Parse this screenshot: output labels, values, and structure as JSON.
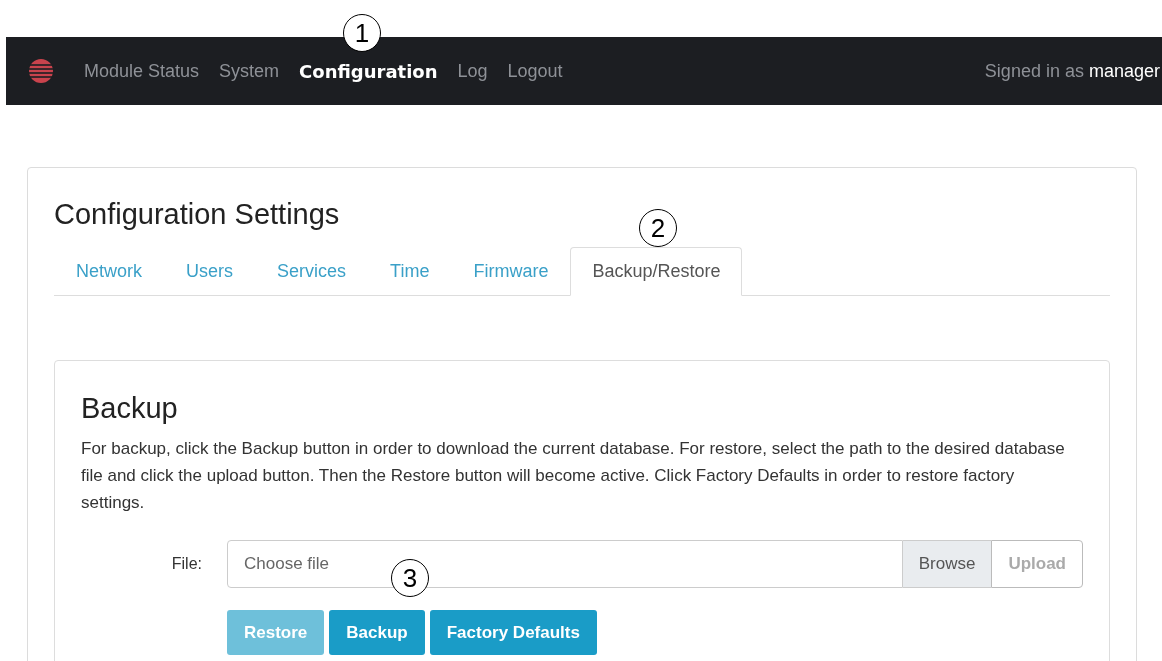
{
  "navbar": {
    "items": [
      {
        "label": "Module Status",
        "selected": false
      },
      {
        "label": "System",
        "selected": false
      },
      {
        "label": "Configuration",
        "selected": true
      },
      {
        "label": "Log",
        "selected": false
      },
      {
        "label": "Logout",
        "selected": false
      }
    ],
    "signed_in_prefix": "Signed in as",
    "signed_in_user": "manager"
  },
  "callouts": [
    "1",
    "2",
    "3"
  ],
  "page_title": "Configuration Settings",
  "tabs": [
    {
      "label": "Network",
      "selected": false
    },
    {
      "label": "Users",
      "selected": false
    },
    {
      "label": "Services",
      "selected": false
    },
    {
      "label": "Time",
      "selected": false
    },
    {
      "label": "Firmware",
      "selected": false
    },
    {
      "label": "Backup/Restore",
      "selected": true
    }
  ],
  "backup": {
    "heading": "Backup",
    "description": "For backup, click the Backup button in order to download the current database. For restore, select the path to the desired database file and click the upload button. Then the Restore button will become active. Click Factory Defaults in order to restore factory settings.",
    "file_label": "File:",
    "placeholder": "Choose file",
    "browse": "Browse",
    "upload": {
      "label": "Upload",
      "disabled": true
    },
    "buttons": [
      {
        "label": "Restore",
        "disabled": true
      },
      {
        "label": "Backup",
        "disabled": false
      },
      {
        "label": "Factory Defaults",
        "disabled": false
      }
    ]
  }
}
